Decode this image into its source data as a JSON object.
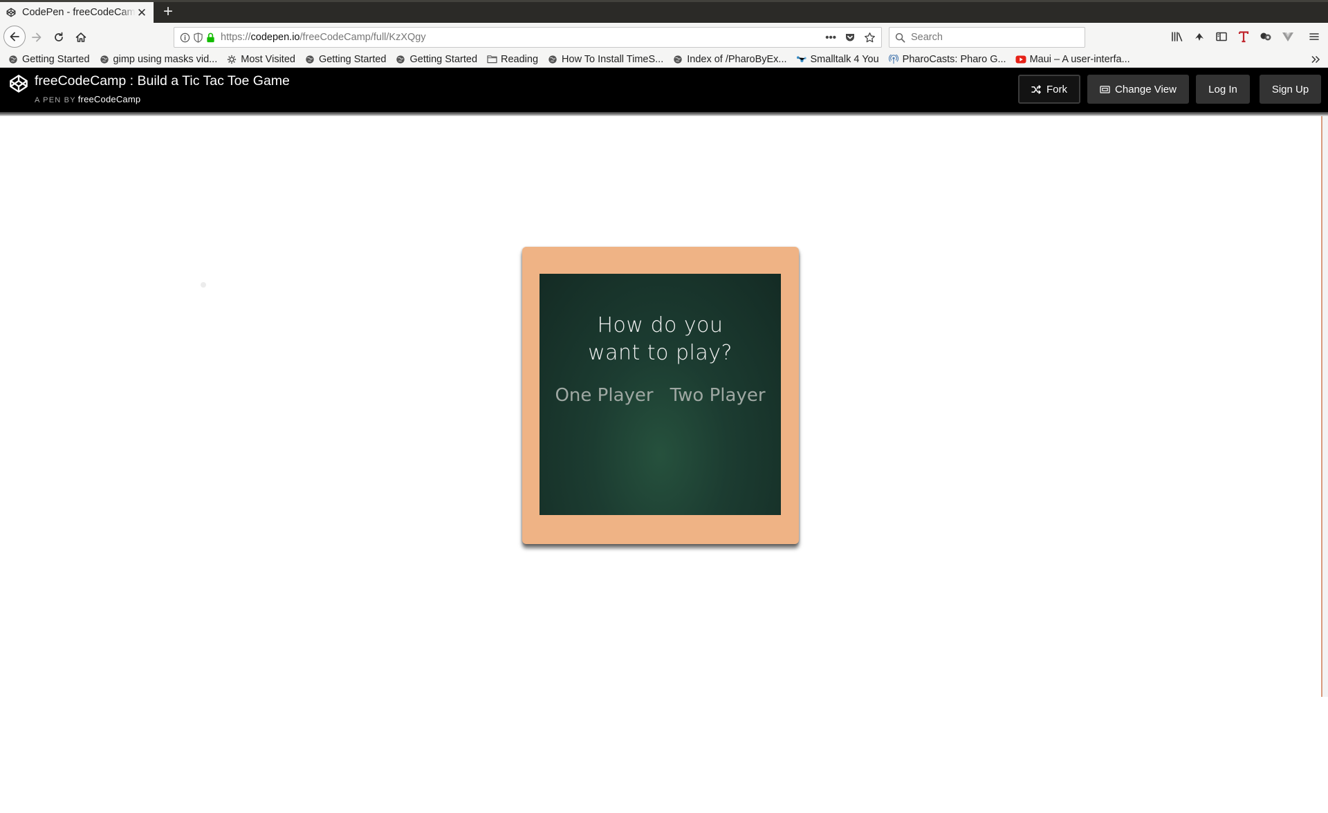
{
  "browser": {
    "tab": {
      "title": "CodePen - freeCodeCamp : Build a Tic Tac Toe Game"
    },
    "url": {
      "scheme": "https://",
      "host": "codepen.io",
      "path": "/freeCodeCamp/full/KzXQgy"
    },
    "search": {
      "placeholder": "Search"
    },
    "bookmarks": [
      {
        "label": "Getting Started",
        "icon": "globe-icon"
      },
      {
        "label": "gimp using masks vid...",
        "icon": "globe-icon"
      },
      {
        "label": "Most Visited",
        "icon": "gear-icon"
      },
      {
        "label": "Getting Started",
        "icon": "globe-icon"
      },
      {
        "label": "Getting Started",
        "icon": "globe-icon"
      },
      {
        "label": "Reading",
        "icon": "folder-icon"
      },
      {
        "label": "How To Install TimeS...",
        "icon": "globe-icon"
      },
      {
        "label": "Index of /PharoByEx...",
        "icon": "globe-icon"
      },
      {
        "label": "Smalltalk 4 You",
        "icon": "network-icon"
      },
      {
        "label": "PharoCasts: Pharo G...",
        "icon": "podcast-icon"
      },
      {
        "label": "Maui – A user-interfa...",
        "icon": "youtube-icon"
      }
    ]
  },
  "codepen": {
    "title": "freeCodeCamp : Build a Tic Tac Toe Game",
    "byline_prefix": "A PEN BY",
    "author": "freeCodeCamp",
    "buttons": {
      "fork": "Fork",
      "change_view": "Change View",
      "log_in": "Log In",
      "sign_up": "Sign Up"
    }
  },
  "game": {
    "question_line1": "How do you",
    "question_line2": "want to play?",
    "option_one": "One Player",
    "option_two": "Two Player",
    "colors": {
      "frame": "#efb385",
      "board": "#1c3c31"
    }
  }
}
